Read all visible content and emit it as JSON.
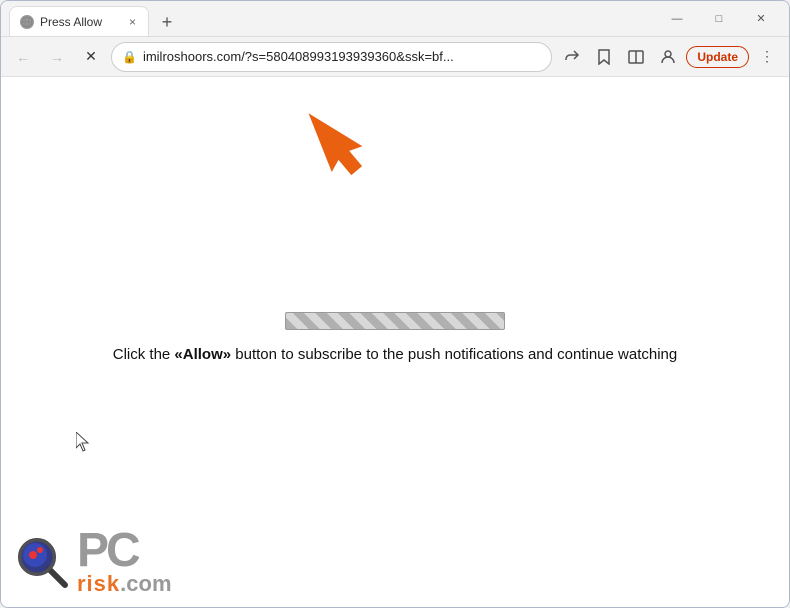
{
  "window": {
    "title": "Press Allow",
    "tab": {
      "favicon": "🌐",
      "title": "Press Allow",
      "close_label": "×"
    },
    "new_tab_label": "+",
    "controls": {
      "minimize": "—",
      "maximize": "□",
      "close": "✕"
    }
  },
  "nav": {
    "back_label": "←",
    "forward_label": "→",
    "reload_label": "✕",
    "url": "imilroshoors.com/?s=580408993193939360&ssk=bf...",
    "share_label": "⬆",
    "bookmark_label": "☆",
    "split_label": "⬜",
    "profile_label": "👤",
    "update_label": "Update",
    "more_label": "⋮"
  },
  "page": {
    "instruction": "Click the «Allow» button to subscribe to the push notifications and continue watching",
    "progress_bar_label": "loading bar"
  },
  "watermark": {
    "pc_text": "PC",
    "risk_text": "risk",
    "com_text": ".com"
  },
  "arrow": {
    "color": "#e86010",
    "label": "arrow pointing to allow button"
  }
}
